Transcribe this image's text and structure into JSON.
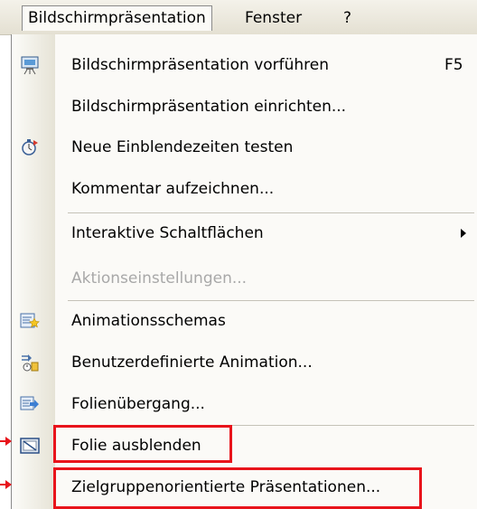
{
  "menubar": {
    "items": [
      {
        "label": "Bildschirmpräsentation",
        "active": true
      },
      {
        "label": "Fenster",
        "active": false
      },
      {
        "label": "?",
        "active": false
      }
    ]
  },
  "menu": {
    "items": [
      {
        "label": "Bildschirmpräsentation vorführen",
        "shortcut": "F5",
        "icon": "projector-icon"
      },
      {
        "label": "Bildschirmpräsentation einrichten...",
        "icon": ""
      },
      {
        "label": "Neue Einblendezeiten testen",
        "icon": "stopwatch-icon"
      },
      {
        "label": "Kommentar aufzeichnen...",
        "icon": ""
      },
      {
        "label": "Interaktive Schaltflächen",
        "icon": "",
        "submenu": true
      },
      {
        "label": "Aktionseinstellungen...",
        "icon": "",
        "disabled": true
      },
      {
        "label": "Animationsschemas",
        "icon": "animation-schemes-icon"
      },
      {
        "label": "Benutzerdefinierte Animation...",
        "icon": "custom-animation-icon"
      },
      {
        "label": "Folienübergang...",
        "icon": "slide-transition-icon"
      },
      {
        "label": "Folie ausblenden",
        "icon": "hide-slide-icon",
        "highlighted": true
      },
      {
        "label": "Zielgruppenorientierte Präsentationen...",
        "icon": "",
        "highlighted": true
      }
    ]
  },
  "colors": {
    "highlight": "#e8141b",
    "menu_bg": "#fbfaf7",
    "disabled_text": "#a8a8a8"
  }
}
